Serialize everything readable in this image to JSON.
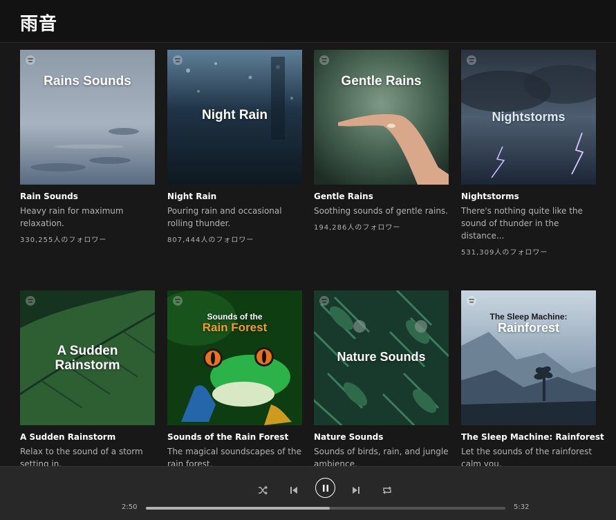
{
  "header": {
    "title": "雨音"
  },
  "playlists": [
    {
      "cover_title": "Rains Sounds",
      "name": "Rain Sounds",
      "description": "Heavy rain for maximum relaxation.",
      "followers": "330,255人のフォロワー"
    },
    {
      "cover_title": "Night Rain",
      "name": "Night Rain",
      "description": "Pouring rain and occasional rolling thunder.",
      "followers": "807,444人のフォロワー"
    },
    {
      "cover_title": "Gentle Rains",
      "name": "Gentle Rains",
      "description": "Soothing sounds of gentle rains.",
      "followers": "194,286人のフォロワー"
    },
    {
      "cover_title": "Nightstorms",
      "name": "Nightstorms",
      "description": "There's nothing quite like the sound of thunder in the distance...",
      "followers": "531,309人のフォロワー"
    },
    {
      "cover_title_line1": "A Sudden",
      "cover_title_line2": "Rainstorm",
      "name": "A Sudden Rainstorm",
      "description": "Relax to the sound of a storm setting in.",
      "followers": ""
    },
    {
      "cover_title_line1": "Sounds of the",
      "cover_title_line2": "Rain Forest",
      "name": "Sounds of the Rain Forest",
      "description": "The magical soundscapes of the rain forest.",
      "followers": ""
    },
    {
      "cover_title": "Nature Sounds",
      "name": "Nature Sounds",
      "description": "Sounds of birds, rain, and jungle ambience.",
      "followers": ""
    },
    {
      "cover_title_line1": "The Sleep Machine:",
      "cover_title_line2": "Rainforest",
      "name": "The Sleep Machine: Rainforest",
      "description": "Let the sounds of the rainforest calm you.",
      "followers": ""
    }
  ],
  "player": {
    "elapsed": "2:50",
    "duration": "5:32",
    "progress": 0.512,
    "controls": [
      "shuffle-icon",
      "previous-icon",
      "pause-icon",
      "next-icon",
      "repeat-icon"
    ]
  },
  "colors": {
    "background": "#181818",
    "header": "#121212",
    "player": "#282828",
    "text_secondary": "#b3b3b3",
    "rainforest_orange": "#f59b23"
  }
}
